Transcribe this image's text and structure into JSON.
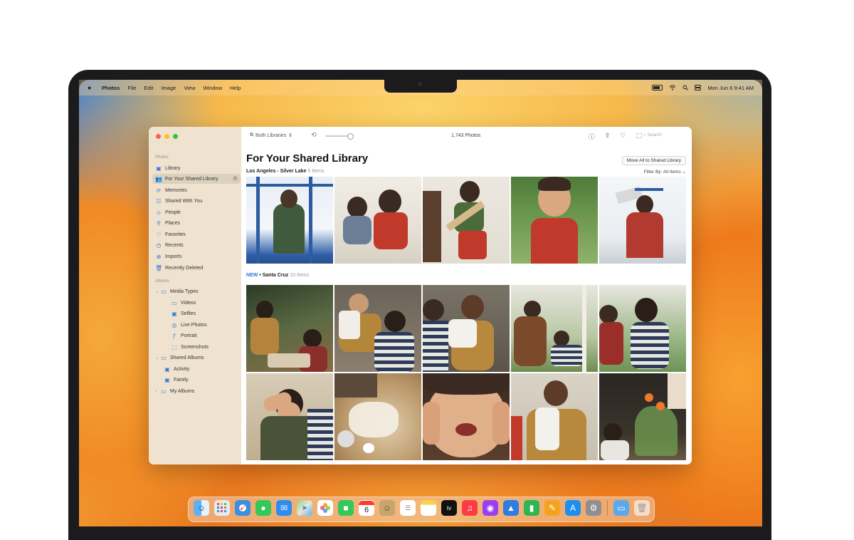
{
  "menubar": {
    "app": "Photos",
    "items": [
      "File",
      "Edit",
      "Image",
      "View",
      "Window",
      "Help"
    ],
    "datetime": "Mon Jun 6  9:41 AM"
  },
  "toolbar": {
    "library_selector": "Both Libraries",
    "photo_count": "1,743 Photos",
    "search_placeholder": "Search"
  },
  "sidebar": {
    "photos_heading": "Photos",
    "items": [
      {
        "label": "Library",
        "icon": "library-icon"
      },
      {
        "label": "For Your Shared Library",
        "icon": "people-icon",
        "badge": "8"
      },
      {
        "label": "Memories",
        "icon": "memories-icon"
      },
      {
        "label": "Shared With You",
        "icon": "shared-icon"
      },
      {
        "label": "People",
        "icon": "person-icon"
      },
      {
        "label": "Places",
        "icon": "map-pin-icon"
      },
      {
        "label": "Favorites",
        "icon": "heart-icon"
      },
      {
        "label": "Recents",
        "icon": "clock-icon"
      },
      {
        "label": "Imports",
        "icon": "import-icon"
      },
      {
        "label": "Recently Deleted",
        "icon": "trash-icon"
      }
    ],
    "albums_heading": "Albums",
    "albums": {
      "media_types": "Media Types",
      "media_items": [
        "Videos",
        "Selfies",
        "Live Photos",
        "Portrait",
        "Screenshots"
      ],
      "shared_albums": "Shared Albums",
      "shared_items": [
        "Activity",
        "Family"
      ],
      "my_albums": "My Albums"
    }
  },
  "main": {
    "title": "For Your Shared Library",
    "move_all_button": "Move All to Shared Library",
    "filter": "Filter By: All Items",
    "section1": {
      "place": "Los Angeles - Silver Lake",
      "count": "5 Items"
    },
    "section2": {
      "new": "NEW",
      "place": "• Santa Cruz",
      "count": "10 Items"
    }
  },
  "dock": {
    "calendar_day": "6",
    "apps": [
      "Finder",
      "Launchpad",
      "Safari",
      "Messages",
      "Mail",
      "Maps",
      "Photos",
      "FaceTime",
      "Calendar",
      "Contacts",
      "Reminders",
      "Notes",
      "TV",
      "Music",
      "Podcasts",
      "Keynote",
      "Numbers",
      "Pages",
      "App Store",
      "System Settings",
      "Downloads",
      "Trash"
    ]
  },
  "colors": {
    "accent": "#1f7ae0",
    "sidebar_bg": "#efe3cf",
    "close": "#ff5f57",
    "minimize": "#febc2e",
    "zoom": "#28c840"
  }
}
